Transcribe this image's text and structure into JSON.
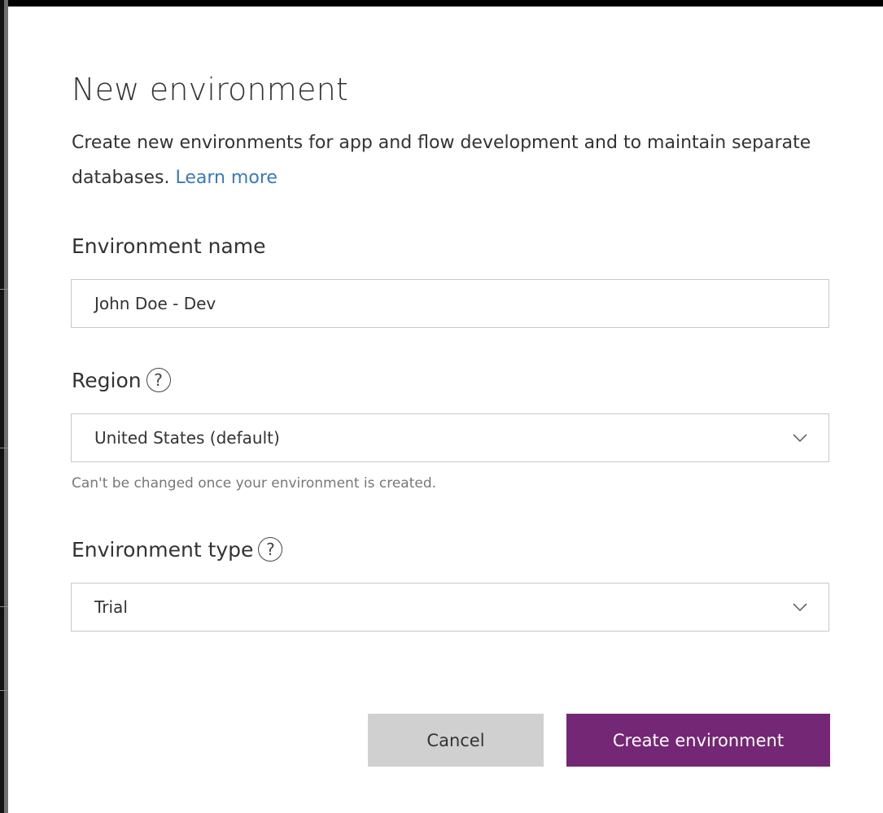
{
  "dialog": {
    "title": "New environment",
    "description": "Create new environments for app and flow development and to maintain separate databases.",
    "learn_more": "Learn more"
  },
  "fields": {
    "name": {
      "label": "Environment name",
      "value": "John Doe - Dev"
    },
    "region": {
      "label": "Region",
      "value": "United States (default)",
      "hint": "Can't be changed once your environment is created.",
      "help_icon": "question-circle-icon"
    },
    "type": {
      "label": "Environment type",
      "value": "Trial",
      "help_icon": "question-circle-icon"
    }
  },
  "buttons": {
    "cancel": "Cancel",
    "create": "Create environment"
  },
  "colors": {
    "primary": "#742774",
    "secondary_button": "#d0d0d0",
    "link": "#3a79b8"
  }
}
